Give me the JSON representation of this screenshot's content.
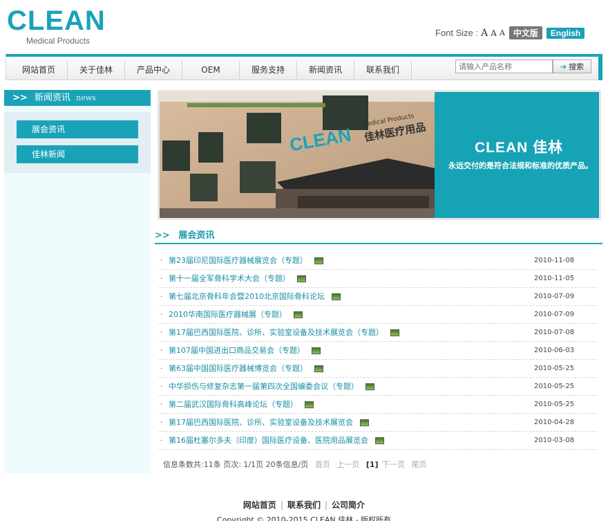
{
  "header": {
    "logo": "CLEAN",
    "logo_sub": "Medical Products",
    "font_size_label": "Font Size :",
    "font_opts": [
      "A",
      "A",
      "A"
    ],
    "lang_cn": "中文版",
    "lang_en": "English"
  },
  "nav": {
    "items": [
      "网站首页",
      "关于佳林",
      "产品中心",
      "OEM",
      "服务支持",
      "新闻资讯",
      "联系我们"
    ],
    "search_placeholder": "请输入产品名称",
    "search_button": "搜索"
  },
  "sidebar": {
    "title": "新闻资讯",
    "title_en": "news",
    "items": [
      "展会资讯",
      "佳林新闻"
    ]
  },
  "banner": {
    "sign_text": "CLEAN",
    "sign_sub": "Medical Products",
    "sign_cn": "佳林医疗用品",
    "panel_title": "CLEAN 佳林",
    "panel_sub": "永远交付的是符合法规和标准的优质产品。"
  },
  "section": {
    "title": "展会资讯"
  },
  "news": [
    {
      "title": "第23届印尼国际医疗器械展览会（专题）",
      "date": "2010-11-08"
    },
    {
      "title": "第十一届全军骨科学术大会（专题）",
      "date": "2010-11-05"
    },
    {
      "title": "第七届北京骨科年会暨2010北京国际骨科论坛",
      "date": "2010-07-09"
    },
    {
      "title": "2010华南国际医疗器械展（专题）",
      "date": "2010-07-09"
    },
    {
      "title": "第17届巴西国际医院、诊所、实验室设备及技术展览会（专题）",
      "date": "2010-07-08"
    },
    {
      "title": "第107届中国进出口商品交易会（专题）",
      "date": "2010-06-03"
    },
    {
      "title": "第63届中国国际医疗器械博览会（专题）",
      "date": "2010-05-25"
    },
    {
      "title": "中华损伤与修复杂志第一届第四次全国编委会议（专题）",
      "date": "2010-05-25"
    },
    {
      "title": "第二届武汉国际骨科高峰论坛（专题）",
      "date": "2010-05-25"
    },
    {
      "title": "第17届巴西国际医院、诊所、实验室设备及技术展览会",
      "date": "2010-04-28"
    },
    {
      "title": "第16届杜塞尔多夫（印度）国际医疗设备、医院用品展览会",
      "date": "2010-03-08"
    }
  ],
  "pager": {
    "info": "信息条数共:11条  页次: 1/1页   20条信息/页",
    "first": "首页",
    "prev": "上一页",
    "current": "[1]",
    "next": "下一页",
    "last": "尾页"
  },
  "footer": {
    "links": [
      "网站首页",
      "联系我们",
      "公司简介"
    ],
    "copyright": "Copyright © 2010-2015 CLEAN 佳林 - 版权所有"
  },
  "colors": {
    "brand": "#1aa3b8"
  }
}
